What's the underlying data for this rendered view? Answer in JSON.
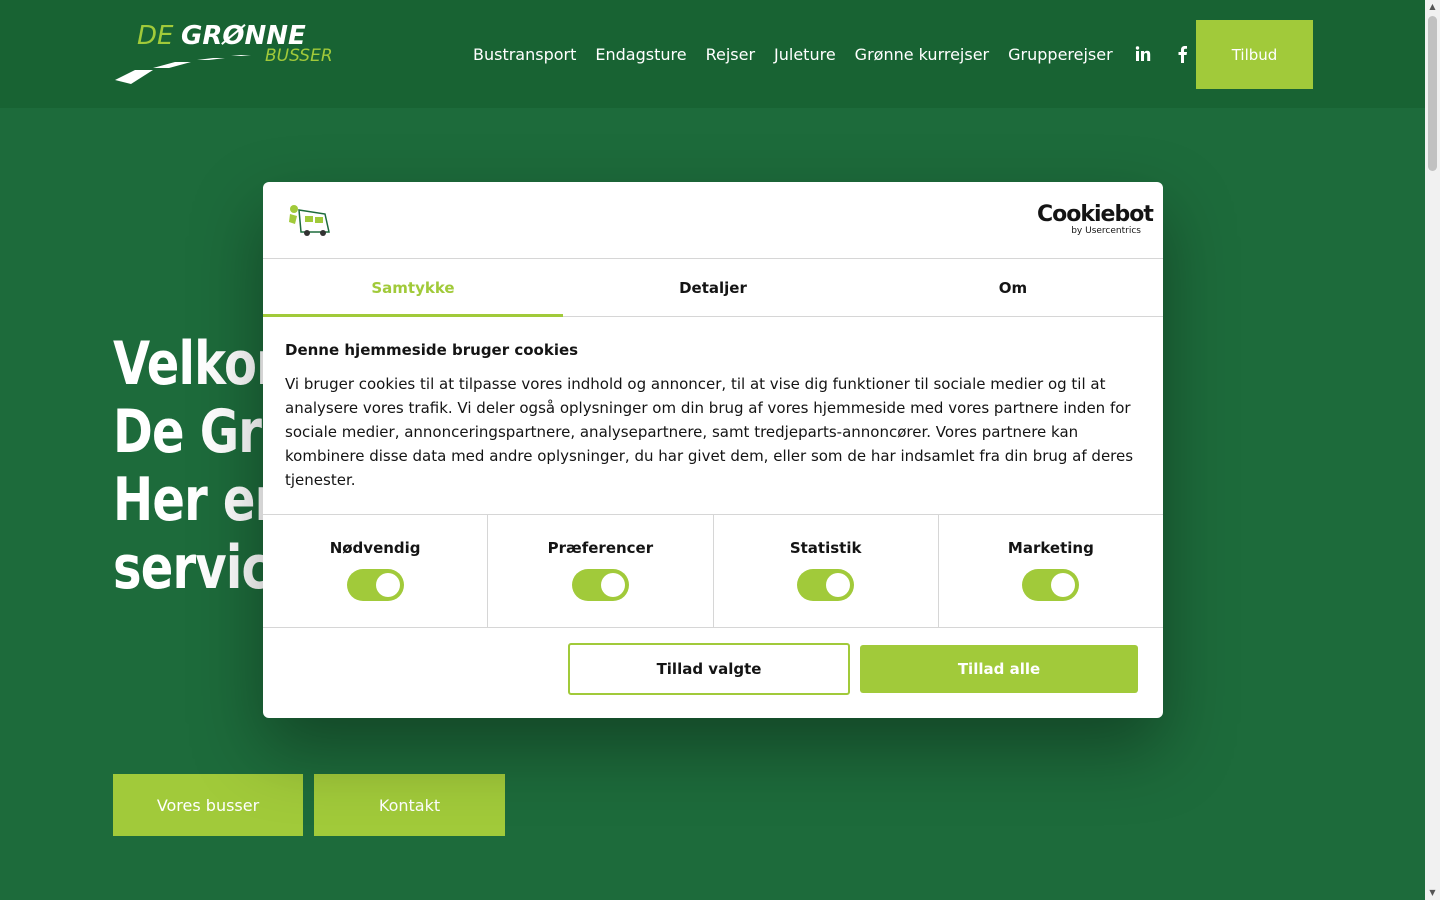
{
  "header": {
    "logo_word_1": "DE",
    "logo_word_2": "GRØNNE",
    "logo_word_3": "BUSSER",
    "nav": [
      "Bustransport",
      "Endagsture",
      "Rejser",
      "Juleture",
      "Grønne kurrejser",
      "Grupperejser"
    ],
    "social": [
      "linkedin-icon",
      "facebook-icon"
    ],
    "cta": "Tilbud"
  },
  "hero": {
    "lines": [
      "Velkommen til",
      "De Grønne Busser.",
      "Her er",
      "service"
    ],
    "buttons": [
      "Vores busser",
      "Kontakt"
    ]
  },
  "cookie_dialog": {
    "brand": "Cookiebot",
    "brand_sub": "by Usercentrics",
    "tabs": [
      "Samtykke",
      "Detaljer",
      "Om"
    ],
    "active_tab": "Samtykke",
    "title": "Denne hjemmeside bruger cookies",
    "text": "Vi bruger cookies til at tilpasse vores indhold og annoncer, til at vise dig funktioner til sociale medier og til at analysere vores trafik. Vi deler også oplysninger om din brug af vores hjemmeside med vores partnere inden for sociale medier, annonceringspartnere, analysepartnere, samt tredjeparts-annoncører. Vores partnere kan kombinere disse data med andre oplysninger, du har givet dem, eller som de har indsamlet fra din brug af deres tjenester.",
    "toggles": [
      {
        "label": "Nødvendig",
        "on": true
      },
      {
        "label": "Præferencer",
        "on": true
      },
      {
        "label": "Statistik",
        "on": true
      },
      {
        "label": "Marketing",
        "on": true
      }
    ],
    "btn_select": "Tillad valgte",
    "btn_all": "Tillad alle"
  },
  "colors": {
    "bg": "#1d6b3b",
    "header": "#186333",
    "accent": "#a1ca3a"
  }
}
